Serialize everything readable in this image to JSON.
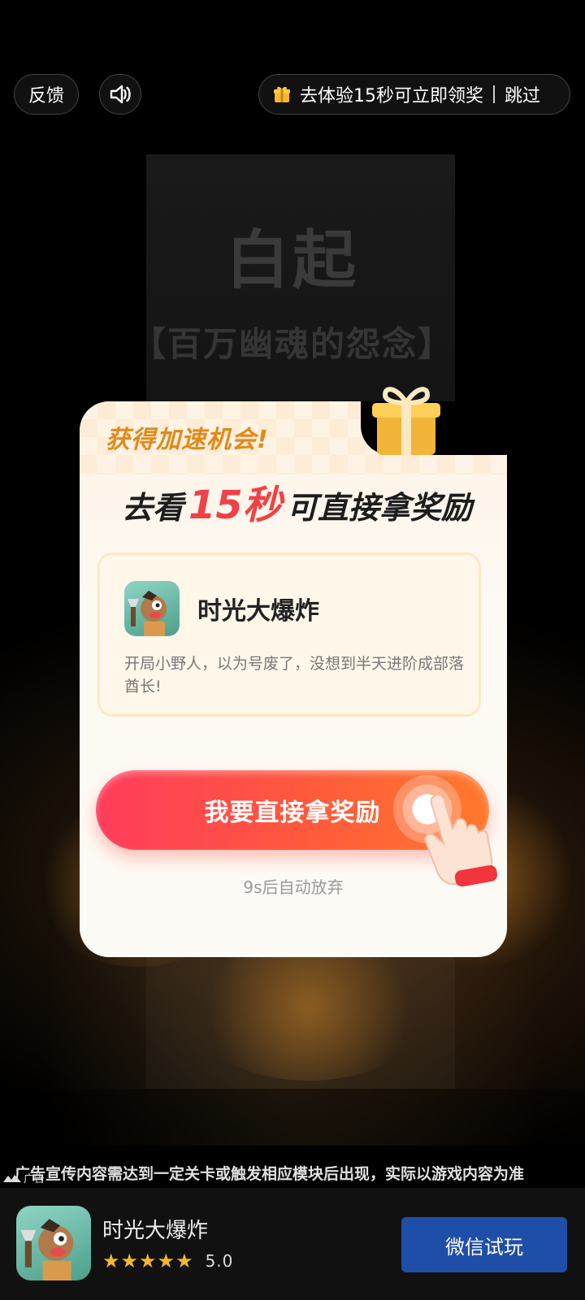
{
  "background": {
    "title": "白起",
    "subtitle": "【百万幽魂的怨念】"
  },
  "topbar": {
    "feedback_label": "反馈",
    "sound_icon": "speaker-icon",
    "reward_text": "去体验15秒可立即领奖",
    "skip_label": "跳过",
    "gift_icon": "gift-icon"
  },
  "dialog": {
    "headline_top": "获得加速机会!",
    "headline_prefix": "去看",
    "headline_seconds": "15秒",
    "headline_suffix": "可直接拿奖励",
    "app": {
      "name": "时光大爆炸",
      "description": "开局小野人，以为号废了，没想到半天进阶成部落酋长!"
    },
    "cta_label": "我要直接拿奖励",
    "auto_text": "9s后自动放弃"
  },
  "bottom": {
    "disclaimer": "广告宣传内容需达到一定关卡或触发相应模块后出现，实际以游戏内容为准",
    "ad_label": "广告",
    "app_name": "时光大爆炸",
    "rating": "5.0",
    "stars": "★★★★★",
    "button_label": "微信试玩"
  },
  "colors": {
    "accent_red": "#f04146",
    "cta_gradient_start": "#ff3c5c",
    "cta_gradient_end": "#ff7a2c",
    "highlight_yellow": "#ffe63a",
    "button_blue": "#1f4ea8",
    "star_gold": "#f5b731"
  }
}
